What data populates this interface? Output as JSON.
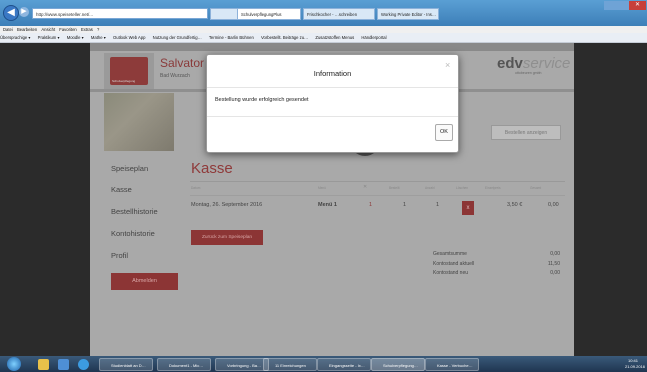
{
  "browser": {
    "address": "http://www.speiseteller.net/...",
    "tabs": [
      {
        "label": "SchulverpflegungPlus"
      },
      {
        "label": "Frischkocher - …schreiben"
      },
      {
        "label": "Working Private Editor - Ins…"
      }
    ],
    "menu": [
      "Datei",
      "Bearbeiten",
      "Ansicht",
      "Favoriten",
      "Extras",
      "?"
    ],
    "favorites": [
      "Übersprachige ▾",
      "Praktikum ▾",
      "Moodle ▾",
      "Mathe ▾",
      "Outlook Web App",
      "Nutzung der Grundfertig…",
      "Termine - Barlin Bühnen",
      "Vorbestellt. Beiträge zu…",
      "Zusatzstoffen Menus",
      "Händlerportal"
    ],
    "close_symbol": "✕"
  },
  "header": {
    "brand_name": "Salvator",
    "brand_city": "Bad Wurzach",
    "logo_text": "Schulverpflegung",
    "edv_main": "edv",
    "edv_accent": "service",
    "edv_sub": "ottobeuren gmbh",
    "auswahl_button": "Bestellen anzeigen"
  },
  "sidebar": {
    "items": [
      {
        "label": "Speiseplan"
      },
      {
        "label": "Kasse"
      },
      {
        "label": "Bestellhistorie"
      },
      {
        "label": "Kontohistorie"
      },
      {
        "label": "Profil"
      }
    ],
    "logout": "Abmelden"
  },
  "main": {
    "title": "Kasse",
    "columns": [
      "Datum",
      "Menü",
      "✕",
      "Bestellt",
      "Anzahl",
      "Löschen",
      "Einzelpreis",
      "Gesamt"
    ],
    "row": {
      "date": "Montag, 26. September 2016",
      "menu": "Menü 1",
      "x_count": "1",
      "ordered": "1",
      "quantity": "1",
      "delete_symbol": "x",
      "unit_price": "3,50 €",
      "total": "0,00"
    },
    "back_button": "Zurück zum Speiseplan",
    "summary": [
      {
        "label": "Gesamtsumme",
        "value": "0,00"
      },
      {
        "label": "Kontostand aktuell",
        "value": "11,50"
      },
      {
        "label": "Kontostand neu",
        "value": "0,00"
      }
    ]
  },
  "modal": {
    "title": "Information",
    "message": "Bestellung wurde erfolgreich gesendet",
    "ok_button": "OK",
    "close_symbol": "×"
  },
  "taskbar": {
    "items": [
      {
        "label": "Studienblatt an D…"
      },
      {
        "label": "Dokument1 - Mic…"
      },
      {
        "label": "Vorbringung - Ba…"
      },
      {
        "label": "11 Einreichungen"
      },
      {
        "label": "Eingangsseite - Ix…"
      },
      {
        "label": "Schulverpflegung…"
      },
      {
        "label": "Kasse - Verbuche…"
      }
    ],
    "time": "10:41",
    "date": "21.09.2016"
  }
}
